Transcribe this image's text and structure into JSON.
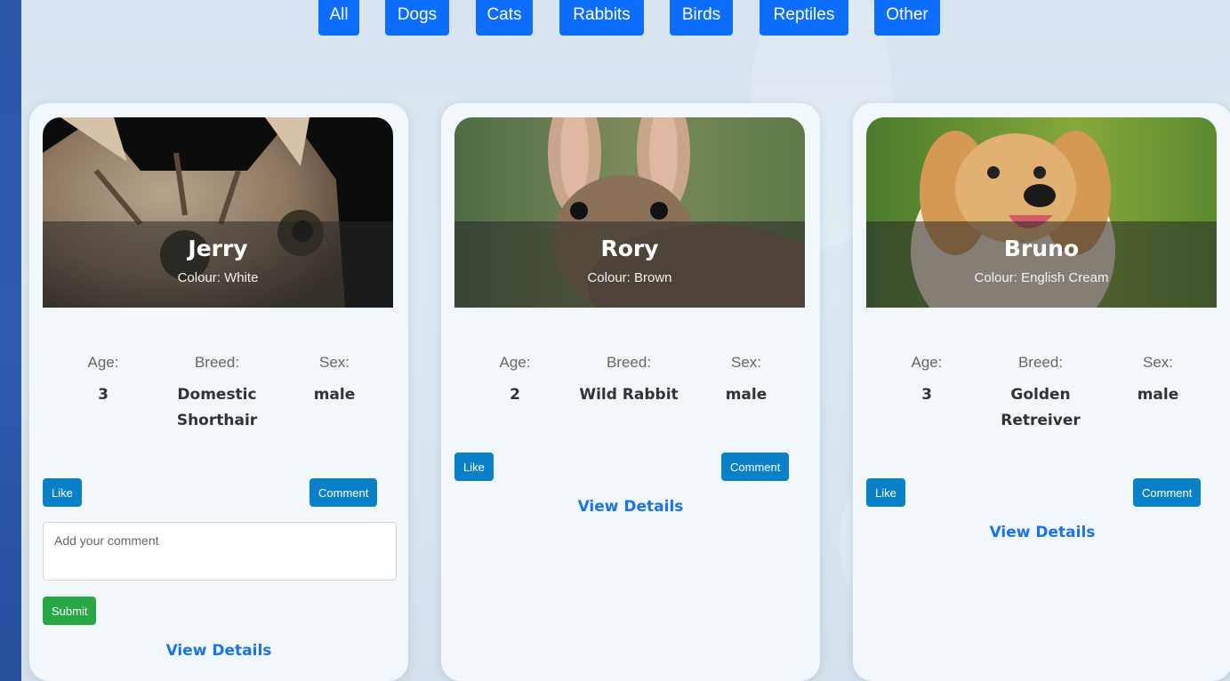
{
  "filters": [
    "All",
    "Dogs",
    "Cats",
    "Rabbits",
    "Birds",
    "Reptiles",
    "Other"
  ],
  "colors": {
    "primary": "#0d6efd",
    "action": "#0a80c8",
    "submit": "#28a745",
    "link": "#1a73e8"
  },
  "labels": {
    "age": "Age:",
    "breed": "Breed:",
    "sex": "Sex:",
    "like": "Like",
    "comment": "Comment",
    "submit": "Submit",
    "view_details": "View Details",
    "comment_placeholder": "Add your comment"
  },
  "pets": [
    {
      "name": "Jerry",
      "colour": "Colour: White",
      "age": "3",
      "breed_lines": [
        "Domestic",
        "Shorthair"
      ],
      "sex": "male",
      "image": "tabby-cat-photo",
      "comment_open": true
    },
    {
      "name": "Rory",
      "colour": "Colour: Brown",
      "age": "2",
      "breed_lines": [
        "Wild Rabbit"
      ],
      "sex": "male",
      "image": "wild-rabbit-photo",
      "comment_open": false
    },
    {
      "name": "Bruno",
      "colour": "Colour: English Cream",
      "age": "3",
      "breed_lines": [
        "Golden",
        "Retreiver"
      ],
      "sex": "male",
      "image": "golden-retriever-photo",
      "comment_open": false
    }
  ]
}
